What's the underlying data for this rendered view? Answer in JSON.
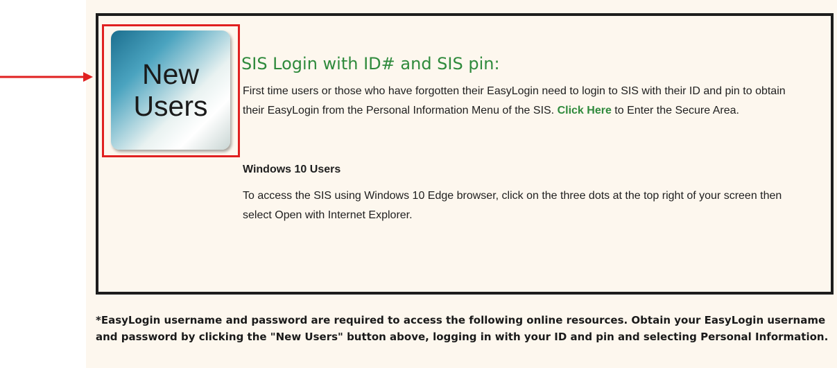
{
  "new_users_button": {
    "line1": "New",
    "line2": "Users"
  },
  "sis_login": {
    "heading": "SIS Login with ID# and SIS pin:",
    "intro_before_link": "First time users or those who have forgotten their EasyLogin need to login to SIS with their ID and pin to obtain their EasyLogin from the Personal Information Menu of the SIS. ",
    "link_label": "Click Here",
    "intro_after_link": " to Enter the Secure Area."
  },
  "windows10": {
    "heading": "Windows 10 Users",
    "text": "To access the SIS using Windows 10 Edge browser, click on the three dots at the top right of your screen then select Open with Internet Explorer."
  },
  "footnote": "*EasyLogin username and password are required to access the following online resources.  Obtain your EasyLogin username and password by clicking the \"New Users\" button above, logging in with your ID and pin and selecting Personal Information.",
  "colors": {
    "accent_green": "#2f8a3c",
    "annotation_red": "#e02020",
    "panel_border": "#1d1d1d",
    "background": "#fdf7ee"
  },
  "icons": {
    "arrow": "right-arrow-icon"
  }
}
